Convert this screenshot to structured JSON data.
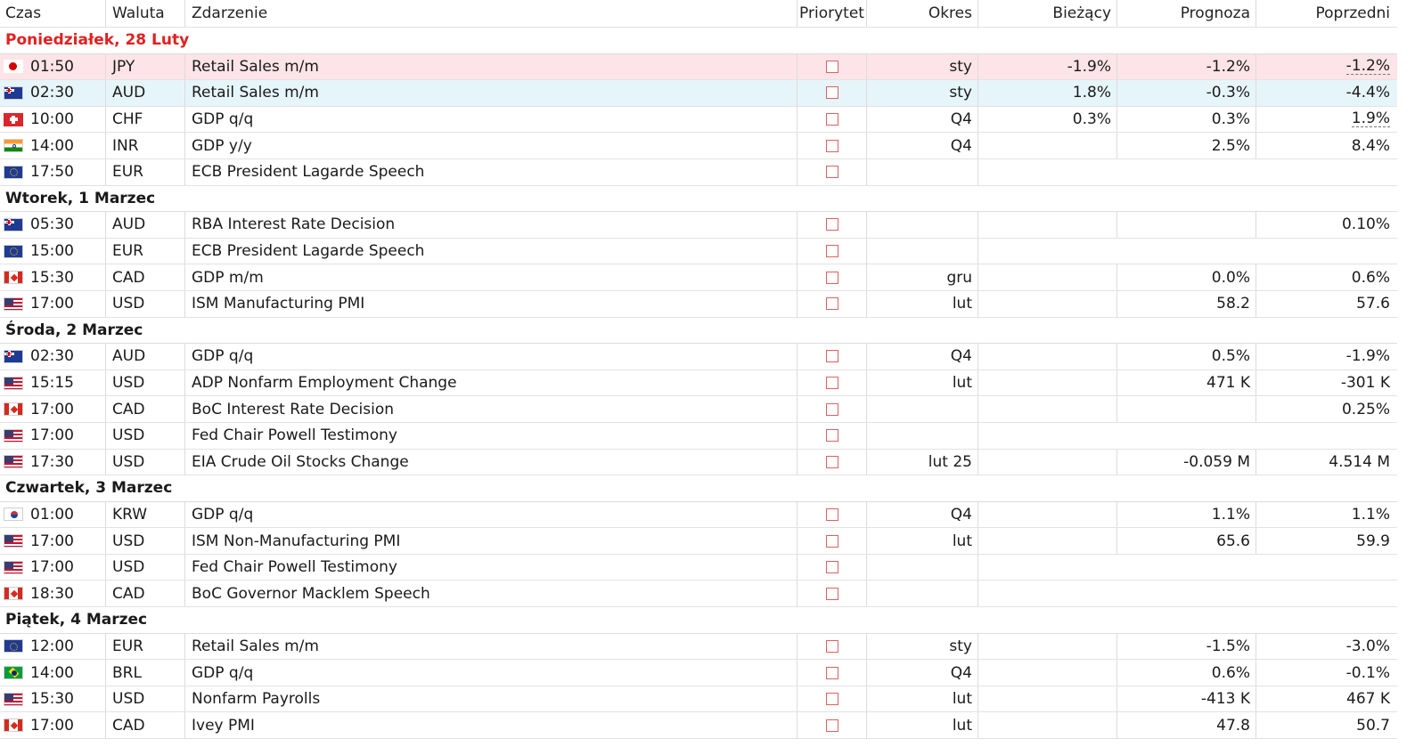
{
  "headers": {
    "time": "Czas",
    "currency": "Waluta",
    "event": "Zdarzenie",
    "priority": "Priorytet",
    "period": "Okres",
    "actual": "Bieżący",
    "forecast": "Prognoza",
    "previous": "Poprzedni"
  },
  "colors": {
    "today_text": "#e02020",
    "highlight_pink": "#fde4e8",
    "highlight_blue": "#e6f5fa",
    "checkbox_border": "#e06060"
  },
  "groups": [
    {
      "label": "Poniedziałek, 28 Luty",
      "today": true,
      "rows": [
        {
          "flag": "jp",
          "time": "01:50",
          "cur": "JPY",
          "event": "Retail Sales m/m",
          "period": "sty",
          "actual": "-1.9%",
          "forecast": "-1.2%",
          "previous": "-1.2%",
          "prev_revised": true,
          "hl": "pink",
          "sep": "full"
        },
        {
          "flag": "au",
          "time": "02:30",
          "cur": "AUD",
          "event": "Retail Sales m/m",
          "period": "sty",
          "actual": "1.8%",
          "forecast": "-0.3%",
          "previous": "-4.4%",
          "hl": "blue",
          "sep": "full"
        },
        {
          "flag": "ch",
          "time": "10:00",
          "cur": "CHF",
          "event": "GDP q/q",
          "period": "Q4",
          "actual": "0.3%",
          "forecast": "0.3%",
          "previous": "1.9%",
          "prev_revised": true,
          "sep": "full"
        },
        {
          "flag": "in",
          "time": "14:00",
          "cur": "INR",
          "event": "GDP y/y",
          "period": "Q4",
          "actual": "",
          "forecast": "2.5%",
          "previous": "8.4%",
          "sep": "full"
        },
        {
          "flag": "eu",
          "time": "17:50",
          "cur": "EUR",
          "event": "ECB President Lagarde Speech",
          "period": "",
          "actual": "",
          "forecast": "",
          "previous": "",
          "sep": "speech"
        }
      ]
    },
    {
      "label": "Wtorek, 1 Marzec",
      "rows": [
        {
          "flag": "au",
          "time": "05:30",
          "cur": "AUD",
          "event": "RBA Interest Rate Decision",
          "period": "",
          "actual": "",
          "forecast": "",
          "previous": "0.10%",
          "sep": "full"
        },
        {
          "flag": "eu",
          "time": "15:00",
          "cur": "EUR",
          "event": "ECB President Lagarde Speech",
          "period": "",
          "actual": "",
          "forecast": "",
          "previous": "",
          "sep": "speech"
        },
        {
          "flag": "ca",
          "time": "15:30",
          "cur": "CAD",
          "event": "GDP m/m",
          "period": "gru",
          "actual": "",
          "forecast": "0.0%",
          "previous": "0.6%",
          "sep": "full"
        },
        {
          "flag": "us",
          "time": "17:00",
          "cur": "USD",
          "event": "ISM Manufacturing PMI",
          "period": "lut",
          "actual": "",
          "forecast": "58.2",
          "previous": "57.6",
          "sep": "full"
        }
      ]
    },
    {
      "label": "Środa, 2 Marzec",
      "rows": [
        {
          "flag": "au",
          "time": "02:30",
          "cur": "AUD",
          "event": "GDP q/q",
          "period": "Q4",
          "actual": "",
          "forecast": "0.5%",
          "previous": "-1.9%",
          "sep": "full"
        },
        {
          "flag": "us",
          "time": "15:15",
          "cur": "USD",
          "event": "ADP Nonfarm Employment Change",
          "period": "lut",
          "actual": "",
          "forecast": "471 K",
          "previous": "-301 K",
          "sep": "full"
        },
        {
          "flag": "ca",
          "time": "17:00",
          "cur": "CAD",
          "event": "BoC Interest Rate Decision",
          "period": "",
          "actual": "",
          "forecast": "",
          "previous": "0.25%",
          "sep": "full"
        },
        {
          "flag": "us",
          "time": "17:00",
          "cur": "USD",
          "event": "Fed Chair Powell Testimony",
          "period": "",
          "actual": "",
          "forecast": "",
          "previous": "",
          "sep": "speech"
        },
        {
          "flag": "us",
          "time": "17:30",
          "cur": "USD",
          "event": "EIA Crude Oil Stocks Change",
          "period": "lut 25",
          "actual": "",
          "forecast": "-0.059 M",
          "previous": "4.514 M",
          "sep": "full"
        }
      ]
    },
    {
      "label": "Czwartek, 3 Marzec",
      "rows": [
        {
          "flag": "kr",
          "time": "01:00",
          "cur": "KRW",
          "event": "GDP q/q",
          "period": "Q4",
          "actual": "",
          "forecast": "1.1%",
          "previous": "1.1%",
          "sep": "full"
        },
        {
          "flag": "us",
          "time": "17:00",
          "cur": "USD",
          "event": "ISM Non-Manufacturing PMI",
          "period": "lut",
          "actual": "",
          "forecast": "65.6",
          "previous": "59.9",
          "sep": "full"
        },
        {
          "flag": "us",
          "time": "17:00",
          "cur": "USD",
          "event": "Fed Chair Powell Testimony",
          "period": "",
          "actual": "",
          "forecast": "",
          "previous": "",
          "sep": "speech"
        },
        {
          "flag": "ca",
          "time": "18:30",
          "cur": "CAD",
          "event": "BoC Governor Macklem Speech",
          "period": "",
          "actual": "",
          "forecast": "",
          "previous": "",
          "sep": "speech"
        }
      ]
    },
    {
      "label": "Piątek, 4 Marzec",
      "rows": [
        {
          "flag": "eu",
          "time": "12:00",
          "cur": "EUR",
          "event": "Retail Sales m/m",
          "period": "sty",
          "actual": "",
          "forecast": "-1.5%",
          "previous": "-3.0%",
          "sep": "full"
        },
        {
          "flag": "br",
          "time": "14:00",
          "cur": "BRL",
          "event": "GDP q/q",
          "period": "Q4",
          "actual": "",
          "forecast": "0.6%",
          "previous": "-0.1%",
          "sep": "full"
        },
        {
          "flag": "us",
          "time": "15:30",
          "cur": "USD",
          "event": "Nonfarm Payrolls",
          "period": "lut",
          "actual": "",
          "forecast": "-413 K",
          "previous": "467 K",
          "sep": "full"
        },
        {
          "flag": "ca",
          "time": "17:00",
          "cur": "CAD",
          "event": "Ivey PMI",
          "period": "lut",
          "actual": "",
          "forecast": "47.8",
          "previous": "50.7",
          "sep": "full"
        }
      ]
    }
  ]
}
